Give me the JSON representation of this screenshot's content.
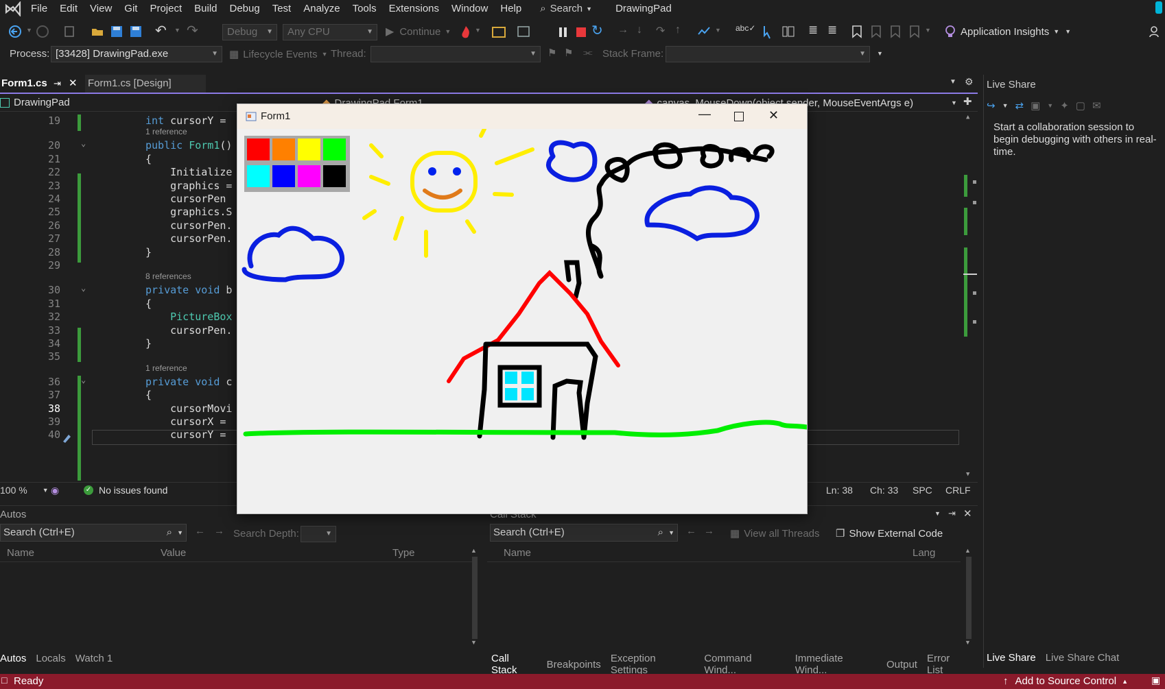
{
  "menu": {
    "items": [
      "File",
      "Edit",
      "View",
      "Git",
      "Project",
      "Build",
      "Debug",
      "Test",
      "Analyze",
      "Tools",
      "Extensions",
      "Window",
      "Help"
    ],
    "search_label": "Search",
    "solution_name": "DrawingPad"
  },
  "toolbar": {
    "config": "Debug",
    "platform": "Any CPU",
    "continue_label": "Continue",
    "app_insights": "Application Insights"
  },
  "debug_toolbar": {
    "process_label": "Process:",
    "process_value": "[33428] DrawingPad.exe",
    "lifecycle_label": "Lifecycle Events",
    "thread_label": "Thread:",
    "stack_frame_label": "Stack Frame:"
  },
  "doc_tabs": {
    "active": "Form1.cs",
    "design": "Form1.cs [Design]"
  },
  "navbar": {
    "project": "DrawingPad",
    "type": "DrawingPad.Form1",
    "member": "canvas_MouseDown(object sender, MouseEventArgs e)"
  },
  "editor": {
    "lines": [
      {
        "n": "19",
        "t": "int cursorY ="
      },
      {
        "n": "20",
        "t": "public Form1()"
      },
      {
        "n": "21",
        "t": "{"
      },
      {
        "n": "22",
        "t": "    Initialize"
      },
      {
        "n": "23",
        "t": "    graphics ="
      },
      {
        "n": "24",
        "t": "    cursorPen"
      },
      {
        "n": "25",
        "t": "    graphics.S"
      },
      {
        "n": "26",
        "t": "    cursorPen."
      },
      {
        "n": "27",
        "t": "    cursorPen."
      },
      {
        "n": "28",
        "t": "}"
      },
      {
        "n": "29",
        "t": ""
      },
      {
        "n": "30",
        "t": "private void b"
      },
      {
        "n": "31",
        "t": "{"
      },
      {
        "n": "32",
        "t": "    PictureBox"
      },
      {
        "n": "33",
        "t": "    cursorPen."
      },
      {
        "n": "34",
        "t": "}"
      },
      {
        "n": "35",
        "t": ""
      },
      {
        "n": "36",
        "t": "private void c"
      },
      {
        "n": "37",
        "t": "{"
      },
      {
        "n": "38",
        "t": "    cursorMovi"
      },
      {
        "n": "39",
        "t": "    cursorX ="
      },
      {
        "n": "40",
        "t": "    cursorY ="
      }
    ],
    "refs": {
      "r1": "1 reference",
      "r8": "8 references",
      "r1b": "1 reference"
    }
  },
  "editor_status": {
    "zoom": "100 %",
    "issues": "No issues found",
    "ln": "Ln: 38",
    "ch": "Ch: 33",
    "spc": "SPC",
    "crlf": "CRLF"
  },
  "form1": {
    "title": "Form1",
    "palette_colors": [
      "#ff0000",
      "#ff8000",
      "#ffff00",
      "#00ff00",
      "#00ffff",
      "#0000ff",
      "#ff00ff",
      "#000000"
    ]
  },
  "live_share": {
    "title": "Live Share",
    "message": "Start a collaboration session to begin debugging with others in real-time.",
    "tabs": [
      "Live Share",
      "Live Share Chat"
    ]
  },
  "autos": {
    "title": "Autos",
    "search_placeholder": "Search (Ctrl+E)",
    "search_depth": "Search Depth:",
    "columns": [
      "Name",
      "Value",
      "Type"
    ],
    "tabs": [
      "Autos",
      "Locals",
      "Watch 1"
    ]
  },
  "callstack": {
    "title": "Call Stack",
    "search_placeholder": "Search (Ctrl+E)",
    "view_threads": "View all Threads",
    "show_external": "Show External Code",
    "columns": [
      "Name",
      "Lang"
    ],
    "tabs": [
      "Call Stack",
      "Breakpoints",
      "Exception Settings",
      "Command Wind...",
      "Immediate Wind...",
      "Output",
      "Error List"
    ]
  },
  "statusbar": {
    "ready": "Ready",
    "source_control": "Add to Source Control"
  },
  "colors": {
    "accent": "#8c7ae6",
    "statusbar": "#8b1a2b",
    "green_change": "#3c9b3c"
  }
}
